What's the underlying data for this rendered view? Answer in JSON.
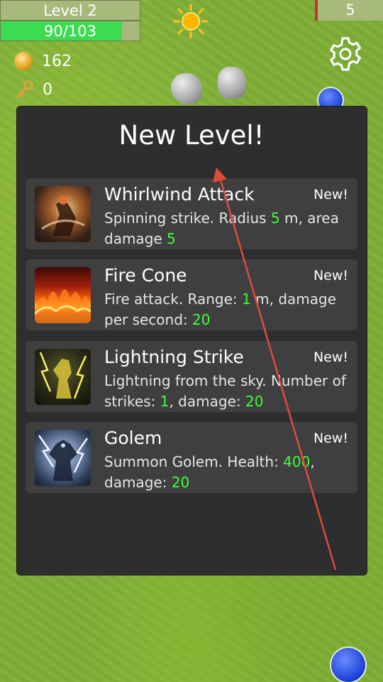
{
  "hud": {
    "level_label": "Level 2",
    "xp_text": "90/103",
    "xp_current": 90,
    "xp_max": 103,
    "wave_count": "5",
    "coins": "162",
    "keys": "0"
  },
  "modal": {
    "title": "New Level!",
    "abilities": [
      {
        "name": "Whirlwind Attack",
        "badge": "New!",
        "desc_parts": [
          "Spinning strike. Radius ",
          "5",
          " m, area damage ",
          "5"
        ],
        "icon": "warrior-whirlwind-icon"
      },
      {
        "name": "Fire Cone",
        "badge": "New!",
        "desc_parts": [
          "Fire attack. Range: ",
          "1",
          " m, damage per second: ",
          "20"
        ],
        "icon": "fire-wall-icon"
      },
      {
        "name": "Lightning Strike",
        "badge": "New!",
        "desc_parts": [
          "Lightning from the sky. Number of strikes: ",
          "1",
          ", damage: ",
          "20"
        ],
        "icon": "lightning-warrior-icon"
      },
      {
        "name": "Golem",
        "badge": "New!",
        "desc_parts": [
          "Summon Golem. Health: ",
          "400",
          ", damage: ",
          "20"
        ],
        "icon": "storm-golem-icon"
      }
    ]
  },
  "colors": {
    "xp_bar": "#3ddb52",
    "highlight": "#3cff3c",
    "modal_bg": "#2e2e2e",
    "card_bg": "#3f3f3f",
    "arrow": "#e04a3a"
  }
}
